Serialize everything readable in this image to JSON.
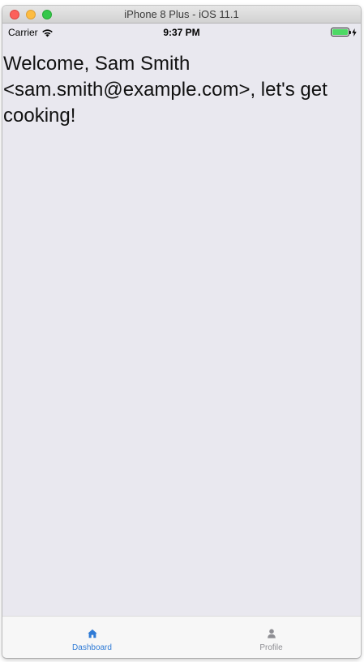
{
  "window": {
    "title": "iPhone 8 Plus - iOS 11.1"
  },
  "status_bar": {
    "carrier": "Carrier",
    "time": "9:37 PM",
    "battery_level": 1.0
  },
  "main": {
    "welcome_text": "Welcome, Sam Smith <sam.smith@example.com>, let's get cooking!"
  },
  "tab_bar": {
    "tabs": [
      {
        "label": "Dashboard",
        "icon": "home-icon",
        "active": true
      },
      {
        "label": "Profile",
        "icon": "user-icon",
        "active": false
      }
    ]
  },
  "colors": {
    "background": "#e9e8ef",
    "tab_active": "#2f7bd6",
    "tab_inactive": "#8e8e93",
    "battery": "#4cd964"
  }
}
